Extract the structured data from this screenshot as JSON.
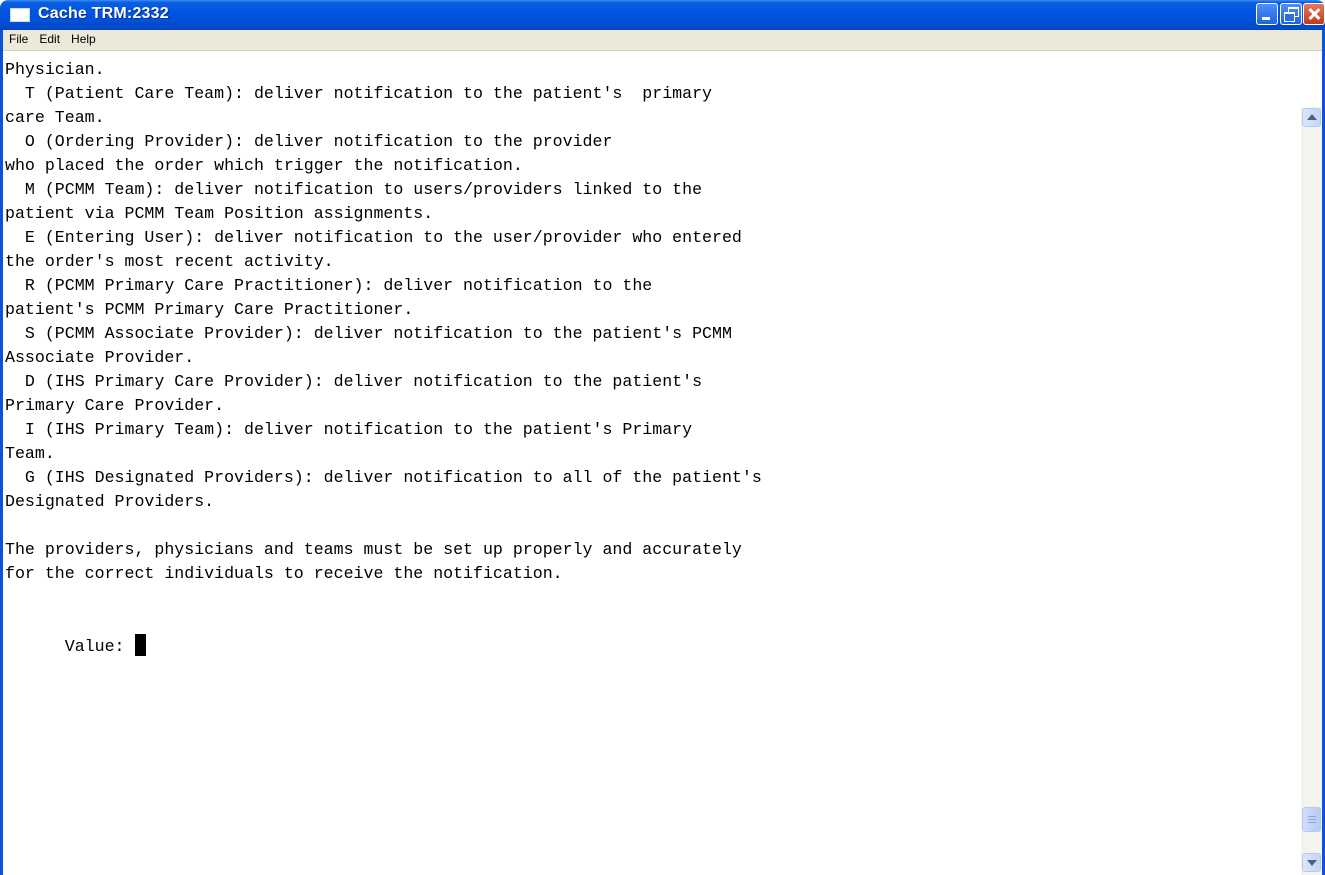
{
  "window": {
    "title": "Cache TRM:2332",
    "minimize_label": "Minimize",
    "maximize_label": "Restore",
    "close_label": "Close"
  },
  "menu": {
    "items": [
      "File",
      "Edit",
      "Help"
    ]
  },
  "terminal": {
    "lines": [
      "Physician.",
      "  T (Patient Care Team): deliver notification to the patient's  primary",
      "care Team.",
      "  O (Ordering Provider): deliver notification to the provider",
      "who placed the order which trigger the notification.",
      "  M (PCMM Team): deliver notification to users/providers linked to the",
      "patient via PCMM Team Position assignments.",
      "  E (Entering User): deliver notification to the user/provider who entered",
      "the order's most recent activity.",
      "  R (PCMM Primary Care Practitioner): deliver notification to the",
      "patient's PCMM Primary Care Practitioner.",
      "  S (PCMM Associate Provider): deliver notification to the patient's PCMM",
      "Associate Provider.",
      "  D (IHS Primary Care Provider): deliver notification to the patient's",
      "Primary Care Provider.",
      "  I (IHS Primary Team): deliver notification to the patient's Primary",
      "Team.",
      "  G (IHS Designated Providers): deliver notification to all of the patient's",
      "Designated Providers.",
      "",
      "The providers, physicians and teams must be set up properly and accurately",
      "for the correct individuals to receive the notification.",
      "",
      ""
    ],
    "prompt": "Value:",
    "input_value": ""
  },
  "scrollbar": {
    "position_fraction": 0.97
  }
}
